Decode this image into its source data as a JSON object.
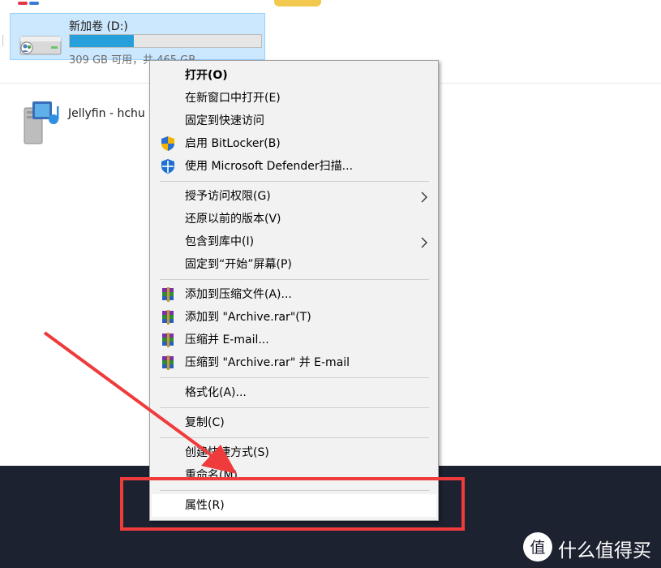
{
  "colors": {
    "menu_bg": "#f2f2f2",
    "selection_bg": "#cce8ff",
    "drive_bar_fill": "#26a0da",
    "taskbar_bg": "#1d2230",
    "annotation_red": "#ef3b3b"
  },
  "drive": {
    "name": "新加卷 (D:)",
    "space_text": "309 GB 可用，共 465 GB",
    "used_fraction": 0.336,
    "icon": "hard-drive-users-icon"
  },
  "media": {
    "label": "Jellyfin - hchu",
    "icon": "media-server-icon"
  },
  "context_menu": {
    "items": [
      {
        "label": "打开(O)",
        "bold": true,
        "icon": null,
        "submenu": false
      },
      {
        "label": "在新窗口中打开(E)",
        "icon": null,
        "submenu": false
      },
      {
        "label": "固定到快速访问",
        "icon": null,
        "submenu": false
      },
      {
        "label": "启用 BitLocker(B)",
        "icon": "uac-shield-icon",
        "submenu": false
      },
      {
        "label": "使用 Microsoft Defender扫描...",
        "icon": "defender-shield-icon",
        "submenu": false
      },
      {
        "label": "授予访问权限(G)",
        "icon": null,
        "submenu": true
      },
      {
        "label": "还原以前的版本(V)",
        "icon": null,
        "submenu": false
      },
      {
        "label": "包含到库中(I)",
        "icon": null,
        "submenu": true
      },
      {
        "label": "固定到“开始”屏幕(P)",
        "icon": null,
        "submenu": false
      },
      {
        "label": "添加到压缩文件(A)...",
        "icon": "winrar-icon",
        "submenu": false
      },
      {
        "label": "添加到 \"Archive.rar\"(T)",
        "icon": "winrar-icon",
        "submenu": false
      },
      {
        "label": "压缩并 E-mail...",
        "icon": "winrar-icon",
        "submenu": false
      },
      {
        "label": "压缩到 \"Archive.rar\" 并 E-mail",
        "icon": "winrar-icon",
        "submenu": false
      },
      {
        "label": "格式化(A)...",
        "icon": null,
        "submenu": false
      },
      {
        "label": "复制(C)",
        "icon": null,
        "submenu": false
      },
      {
        "label": "创建快捷方式(S)",
        "icon": null,
        "submenu": false
      },
      {
        "label": "重命名(M)",
        "icon": null,
        "submenu": false
      },
      {
        "label": "属性(R)",
        "icon": null,
        "submenu": false,
        "highlighted": true
      }
    ]
  },
  "watermark": {
    "logo_glyph": "值",
    "text": "什么值得买"
  }
}
